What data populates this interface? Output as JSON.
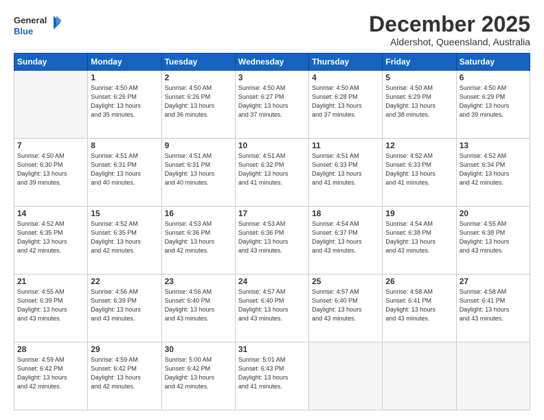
{
  "header": {
    "logo_general": "General",
    "logo_blue": "Blue",
    "month": "December 2025",
    "location": "Aldershot, Queensland, Australia"
  },
  "days_of_week": [
    "Sunday",
    "Monday",
    "Tuesday",
    "Wednesday",
    "Thursday",
    "Friday",
    "Saturday"
  ],
  "weeks": [
    [
      {
        "day": "",
        "content": ""
      },
      {
        "day": "1",
        "content": "Sunrise: 4:50 AM\nSunset: 6:26 PM\nDaylight: 13 hours\nand 35 minutes."
      },
      {
        "day": "2",
        "content": "Sunrise: 4:50 AM\nSunset: 6:26 PM\nDaylight: 13 hours\nand 36 minutes."
      },
      {
        "day": "3",
        "content": "Sunrise: 4:50 AM\nSunset: 6:27 PM\nDaylight: 13 hours\nand 37 minutes."
      },
      {
        "day": "4",
        "content": "Sunrise: 4:50 AM\nSunset: 6:28 PM\nDaylight: 13 hours\nand 37 minutes."
      },
      {
        "day": "5",
        "content": "Sunrise: 4:50 AM\nSunset: 6:29 PM\nDaylight: 13 hours\nand 38 minutes."
      },
      {
        "day": "6",
        "content": "Sunrise: 4:50 AM\nSunset: 6:29 PM\nDaylight: 13 hours\nand 39 minutes."
      }
    ],
    [
      {
        "day": "7",
        "content": "Sunrise: 4:50 AM\nSunset: 6:30 PM\nDaylight: 13 hours\nand 39 minutes."
      },
      {
        "day": "8",
        "content": "Sunrise: 4:51 AM\nSunset: 6:31 PM\nDaylight: 13 hours\nand 40 minutes."
      },
      {
        "day": "9",
        "content": "Sunrise: 4:51 AM\nSunset: 6:31 PM\nDaylight: 13 hours\nand 40 minutes."
      },
      {
        "day": "10",
        "content": "Sunrise: 4:51 AM\nSunset: 6:32 PM\nDaylight: 13 hours\nand 41 minutes."
      },
      {
        "day": "11",
        "content": "Sunrise: 4:51 AM\nSunset: 6:33 PM\nDaylight: 13 hours\nand 41 minutes."
      },
      {
        "day": "12",
        "content": "Sunrise: 4:52 AM\nSunset: 6:33 PM\nDaylight: 13 hours\nand 41 minutes."
      },
      {
        "day": "13",
        "content": "Sunrise: 4:52 AM\nSunset: 6:34 PM\nDaylight: 13 hours\nand 42 minutes."
      }
    ],
    [
      {
        "day": "14",
        "content": "Sunrise: 4:52 AM\nSunset: 6:35 PM\nDaylight: 13 hours\nand 42 minutes."
      },
      {
        "day": "15",
        "content": "Sunrise: 4:52 AM\nSunset: 6:35 PM\nDaylight: 13 hours\nand 42 minutes."
      },
      {
        "day": "16",
        "content": "Sunrise: 4:53 AM\nSunset: 6:36 PM\nDaylight: 13 hours\nand 42 minutes."
      },
      {
        "day": "17",
        "content": "Sunrise: 4:53 AM\nSunset: 6:36 PM\nDaylight: 13 hours\nand 43 minutes."
      },
      {
        "day": "18",
        "content": "Sunrise: 4:54 AM\nSunset: 6:37 PM\nDaylight: 13 hours\nand 43 minutes."
      },
      {
        "day": "19",
        "content": "Sunrise: 4:54 AM\nSunset: 6:38 PM\nDaylight: 13 hours\nand 43 minutes."
      },
      {
        "day": "20",
        "content": "Sunrise: 4:55 AM\nSunset: 6:38 PM\nDaylight: 13 hours\nand 43 minutes."
      }
    ],
    [
      {
        "day": "21",
        "content": "Sunrise: 4:55 AM\nSunset: 6:39 PM\nDaylight: 13 hours\nand 43 minutes."
      },
      {
        "day": "22",
        "content": "Sunrise: 4:56 AM\nSunset: 6:39 PM\nDaylight: 13 hours\nand 43 minutes."
      },
      {
        "day": "23",
        "content": "Sunrise: 4:56 AM\nSunset: 6:40 PM\nDaylight: 13 hours\nand 43 minutes."
      },
      {
        "day": "24",
        "content": "Sunrise: 4:57 AM\nSunset: 6:40 PM\nDaylight: 13 hours\nand 43 minutes."
      },
      {
        "day": "25",
        "content": "Sunrise: 4:57 AM\nSunset: 6:40 PM\nDaylight: 13 hours\nand 43 minutes."
      },
      {
        "day": "26",
        "content": "Sunrise: 4:58 AM\nSunset: 6:41 PM\nDaylight: 13 hours\nand 43 minutes."
      },
      {
        "day": "27",
        "content": "Sunrise: 4:58 AM\nSunset: 6:41 PM\nDaylight: 13 hours\nand 43 minutes."
      }
    ],
    [
      {
        "day": "28",
        "content": "Sunrise: 4:59 AM\nSunset: 6:42 PM\nDaylight: 13 hours\nand 42 minutes."
      },
      {
        "day": "29",
        "content": "Sunrise: 4:59 AM\nSunset: 6:42 PM\nDaylight: 13 hours\nand 42 minutes."
      },
      {
        "day": "30",
        "content": "Sunrise: 5:00 AM\nSunset: 6:42 PM\nDaylight: 13 hours\nand 42 minutes."
      },
      {
        "day": "31",
        "content": "Sunrise: 5:01 AM\nSunset: 6:43 PM\nDaylight: 13 hours\nand 41 minutes."
      },
      {
        "day": "",
        "content": ""
      },
      {
        "day": "",
        "content": ""
      },
      {
        "day": "",
        "content": ""
      }
    ]
  ]
}
